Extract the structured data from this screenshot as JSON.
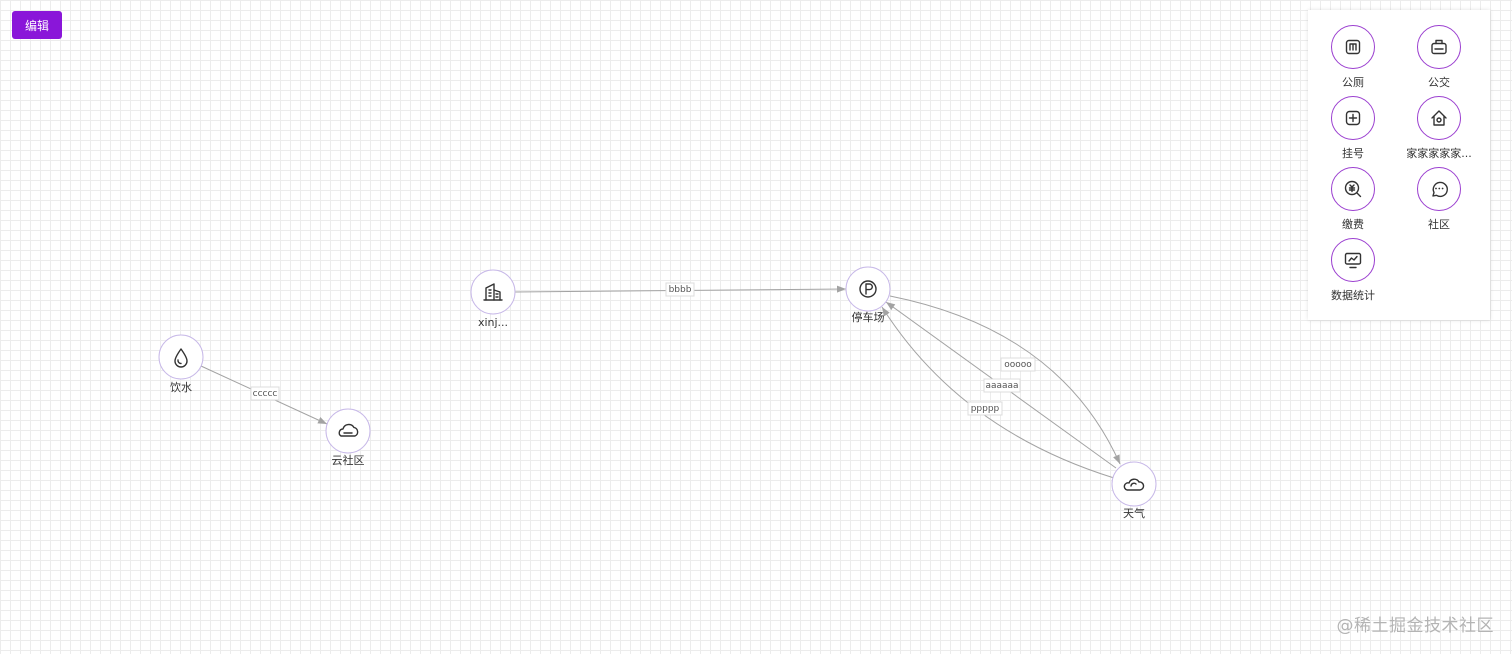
{
  "toolbar": {
    "edit_label": "编辑"
  },
  "nodes": [
    {
      "id": "yinshui",
      "label": "饮水",
      "icon": "water-drop-icon"
    },
    {
      "id": "yunshequ",
      "label": "云社区",
      "icon": "cloud-icon"
    },
    {
      "id": "xinj",
      "label": "xinj...",
      "icon": "building-icon"
    },
    {
      "id": "tingchechang",
      "label": "停车场",
      "icon": "parking-icon"
    },
    {
      "id": "tianqi",
      "label": "天气",
      "icon": "weather-cloud-sun-icon"
    }
  ],
  "edges": [
    {
      "label": "ccccc",
      "from": "饮水",
      "to": "云社区"
    },
    {
      "label": "bbbb",
      "from": "xinj...",
      "to": "停车场",
      "bidirectional": true
    },
    {
      "label": "ooooo",
      "from": "停车场",
      "to": "天气"
    },
    {
      "label": "aaaaaa",
      "from": "天气",
      "to": "停车场"
    },
    {
      "label": "ppppp",
      "from": "天气",
      "to": "停车场"
    }
  ],
  "palette": {
    "items": [
      {
        "label": "公厕",
        "icon": "toilet-icon"
      },
      {
        "label": "公交",
        "icon": "bus-icon"
      },
      {
        "label": "挂号",
        "icon": "register-plus-icon"
      },
      {
        "label": "家家家家家...",
        "icon": "home-icon"
      },
      {
        "label": "缴费",
        "icon": "payment-icon"
      },
      {
        "label": "社区",
        "icon": "chat-bubble-icon"
      },
      {
        "label": "数据统计",
        "icon": "monitor-chart-icon"
      }
    ]
  },
  "watermark": "@稀土掘金技术社区",
  "colors": {
    "accent": "#8a16d9",
    "palette_border": "#9b3fd0",
    "node_border": "#c7b8e8",
    "edge": "#a3a3a3"
  }
}
